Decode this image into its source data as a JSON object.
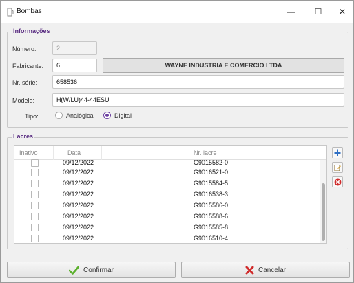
{
  "window": {
    "title": "Bombas",
    "controls": {
      "minimize": "—",
      "maximize": "☐",
      "close": "✕"
    }
  },
  "info": {
    "group_title": "Informações",
    "numero_label": "Número:",
    "numero_value": "2",
    "fabricante_label": "Fabricante:",
    "fabricante_value": "6",
    "fabricante_name": "WAYNE INDUSTRIA E COMERCIO LTDA",
    "serie_label": "Nr. série:",
    "serie_value": "658536",
    "modelo_label": "Modelo:",
    "modelo_value": "H(W/LU)44-44ESU",
    "tipo_label": "Tipo:",
    "tipo_options": [
      "Analógica",
      "Digital"
    ],
    "tipo_selected": "Digital"
  },
  "lacres": {
    "group_title": "Lacres",
    "columns": [
      "Inativo",
      "Data",
      "Nr. lacre"
    ],
    "rows": [
      {
        "data": "09/12/2022",
        "lacre": "G9015582-0"
      },
      {
        "data": "09/12/2022",
        "lacre": "G9016521-0"
      },
      {
        "data": "09/12/2022",
        "lacre": "G9015584-5"
      },
      {
        "data": "09/12/2022",
        "lacre": "G9016538-3"
      },
      {
        "data": "09/12/2022",
        "lacre": "G9015586-0"
      },
      {
        "data": "09/12/2022",
        "lacre": "G9015588-6"
      },
      {
        "data": "09/12/2022",
        "lacre": "G9015585-8"
      },
      {
        "data": "09/12/2022",
        "lacre": "G9016510-4"
      }
    ]
  },
  "actions": {
    "confirm_label": "Confirmar",
    "cancel_label": "Cancelar"
  },
  "colors": {
    "accent": "#5a2d82",
    "add": "#2f6fc4",
    "remove": "#d02a2a",
    "confirm": "#5bb02c"
  }
}
